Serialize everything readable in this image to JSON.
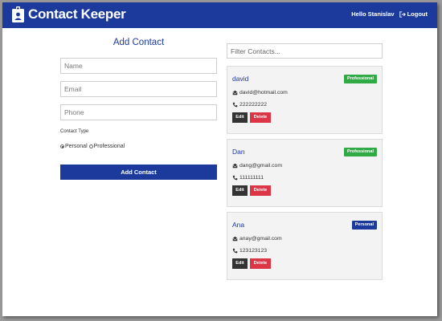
{
  "navbar": {
    "brand_icon": "id-badge-icon",
    "title": "Contact Keeper",
    "greeting": "Hello Stanislav",
    "logout_label": "Logout",
    "color": "#1b3a9c"
  },
  "form": {
    "title": "Add Contact",
    "name_placeholder": "Name",
    "email_placeholder": "Email",
    "phone_placeholder": "Phone",
    "type_label": "Contact Type",
    "options": [
      "Personal",
      "Professional"
    ],
    "selected_option": "Personal",
    "submit_label": "Add Contact"
  },
  "filter": {
    "placeholder": "Filter Contacts..."
  },
  "contacts": [
    {
      "name": "david",
      "type": "Professional",
      "email": "david@hotmail.com",
      "phone": "222222222"
    },
    {
      "name": "Dan",
      "type": "Professional",
      "email": "dang@gmail.com",
      "phone": "111111111"
    },
    {
      "name": "Ana",
      "type": "Personal",
      "email": "anay@gmail.com",
      "phone": "123123123"
    }
  ],
  "card_actions": {
    "edit": "Edit",
    "delete": "Delete"
  },
  "colors": {
    "professional": "#2faa45",
    "personal": "#1b3a9c",
    "delete": "#dc3545",
    "edit": "#333333"
  }
}
